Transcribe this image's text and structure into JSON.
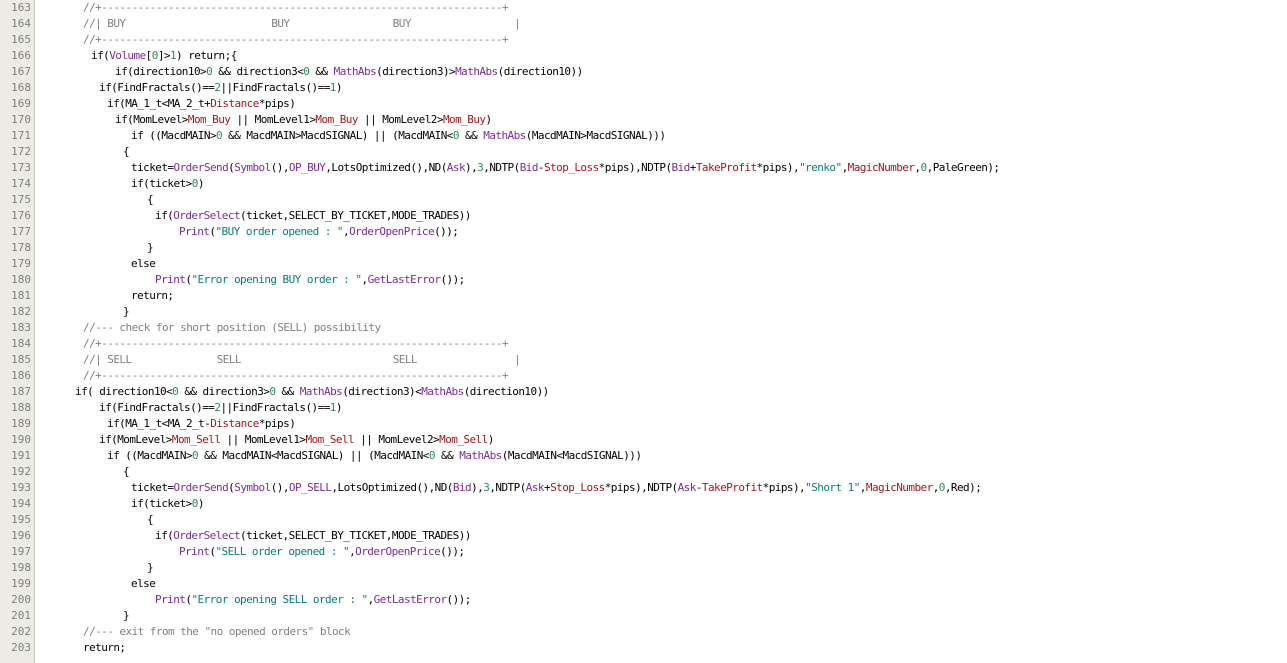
{
  "editor": {
    "gutter_bg": "#ecebe4",
    "colors": {
      "comment": "#808080",
      "function": "#7a2b97",
      "number": "#2e8b57",
      "string": "#0a7a7a",
      "identifier_red": "#a4161a",
      "plain": "#000000"
    },
    "lines": [
      {
        "num": "163",
        "indent": 48,
        "tokens": [
          {
            "t": "//+------------------------------------------------------------------+",
            "c": "c"
          }
        ]
      },
      {
        "num": "164",
        "indent": 48,
        "tokens": [
          {
            "t": "//| BUY                        BUY                 BUY                 |",
            "c": "c"
          }
        ]
      },
      {
        "num": "165",
        "indent": 48,
        "tokens": [
          {
            "t": "//+------------------------------------------------------------------+",
            "c": "c"
          }
        ]
      },
      {
        "num": "166",
        "indent": 56,
        "tokens": [
          {
            "t": "if(",
            "c": "k"
          },
          {
            "t": "Volume",
            "c": "f"
          },
          {
            "t": "[",
            "c": "k"
          },
          {
            "t": "0",
            "c": "n"
          },
          {
            "t": "]>",
            "c": "k"
          },
          {
            "t": "1",
            "c": "n"
          },
          {
            "t": ") return;{",
            "c": "k"
          }
        ]
      },
      {
        "num": "167",
        "indent": 80,
        "tokens": [
          {
            "t": "if(direction10>",
            "c": "k"
          },
          {
            "t": "0",
            "c": "n"
          },
          {
            "t": " && direction3<",
            "c": "k"
          },
          {
            "t": "0",
            "c": "n"
          },
          {
            "t": " && ",
            "c": "k"
          },
          {
            "t": "MathAbs",
            "c": "f"
          },
          {
            "t": "(direction3)>",
            "c": "k"
          },
          {
            "t": "MathAbs",
            "c": "f"
          },
          {
            "t": "(direction10))",
            "c": "k"
          }
        ]
      },
      {
        "num": "168",
        "indent": 64,
        "tokens": [
          {
            "t": "if(FindFractals()==",
            "c": "k"
          },
          {
            "t": "2",
            "c": "n"
          },
          {
            "t": "||FindFractals()==",
            "c": "k"
          },
          {
            "t": "1",
            "c": "n"
          },
          {
            "t": ")",
            "c": "k"
          }
        ]
      },
      {
        "num": "169",
        "indent": 72,
        "tokens": [
          {
            "t": "if(MA_1_t<MA_2_t+",
            "c": "k"
          },
          {
            "t": "Distance",
            "c": "r"
          },
          {
            "t": "*pips)",
            "c": "k"
          }
        ]
      },
      {
        "num": "170",
        "indent": 80,
        "tokens": [
          {
            "t": "if(MomLevel>",
            "c": "k"
          },
          {
            "t": "Mom_Buy",
            "c": "r"
          },
          {
            "t": " || MomLevel1>",
            "c": "k"
          },
          {
            "t": "Mom_Buy",
            "c": "r"
          },
          {
            "t": " || MomLevel2>",
            "c": "k"
          },
          {
            "t": "Mom_Buy",
            "c": "r"
          },
          {
            "t": ")",
            "c": "k"
          }
        ]
      },
      {
        "num": "171",
        "indent": 96,
        "tokens": [
          {
            "t": "if ((MacdMAIN>",
            "c": "k"
          },
          {
            "t": "0",
            "c": "n"
          },
          {
            "t": " && MacdMAIN>MacdSIGNAL) || (MacdMAIN<",
            "c": "k"
          },
          {
            "t": "0",
            "c": "n"
          },
          {
            "t": " && ",
            "c": "k"
          },
          {
            "t": "MathAbs",
            "c": "f"
          },
          {
            "t": "(MacdMAIN>MacdSIGNAL)))",
            "c": "k"
          }
        ]
      },
      {
        "num": "172",
        "indent": 88,
        "tokens": [
          {
            "t": "{",
            "c": "k"
          }
        ]
      },
      {
        "num": "173",
        "indent": 96,
        "tokens": [
          {
            "t": "ticket=",
            "c": "k"
          },
          {
            "t": "OrderSend",
            "c": "f"
          },
          {
            "t": "(",
            "c": "k"
          },
          {
            "t": "Symbol",
            "c": "f"
          },
          {
            "t": "(),",
            "c": "k"
          },
          {
            "t": "OP_BUY",
            "c": "f"
          },
          {
            "t": ",LotsOptimized(),ND(",
            "c": "k"
          },
          {
            "t": "Ask",
            "c": "f"
          },
          {
            "t": "),",
            "c": "k"
          },
          {
            "t": "3",
            "c": "n"
          },
          {
            "t": ",NDTP(",
            "c": "k"
          },
          {
            "t": "Bid",
            "c": "f"
          },
          {
            "t": "-",
            "c": "k"
          },
          {
            "t": "Stop_Loss",
            "c": "r"
          },
          {
            "t": "*pips),NDTP(",
            "c": "k"
          },
          {
            "t": "Bid",
            "c": "f"
          },
          {
            "t": "+",
            "c": "k"
          },
          {
            "t": "TakeProfit",
            "c": "r"
          },
          {
            "t": "*pips),",
            "c": "k"
          },
          {
            "t": "\"renko\"",
            "c": "s"
          },
          {
            "t": ",",
            "c": "k"
          },
          {
            "t": "MagicNumber",
            "c": "r"
          },
          {
            "t": ",",
            "c": "k"
          },
          {
            "t": "0",
            "c": "n"
          },
          {
            "t": ",PaleGreen);",
            "c": "k"
          }
        ]
      },
      {
        "num": "174",
        "indent": 96,
        "tokens": [
          {
            "t": "if(ticket>",
            "c": "k"
          },
          {
            "t": "0",
            "c": "n"
          },
          {
            "t": ")",
            "c": "k"
          }
        ]
      },
      {
        "num": "175",
        "indent": 112,
        "tokens": [
          {
            "t": "{",
            "c": "k"
          }
        ]
      },
      {
        "num": "176",
        "indent": 120,
        "tokens": [
          {
            "t": "if(",
            "c": "k"
          },
          {
            "t": "OrderSelect",
            "c": "f"
          },
          {
            "t": "(ticket,",
            "c": "k"
          },
          {
            "t": "SELECT_BY_TICKET",
            "c": "k"
          },
          {
            "t": ",",
            "c": "k"
          },
          {
            "t": "MODE_TRADES",
            "c": "k"
          },
          {
            "t": "))",
            "c": "k"
          }
        ]
      },
      {
        "num": "177",
        "indent": 144,
        "tokens": [
          {
            "t": "Print",
            "c": "f"
          },
          {
            "t": "(",
            "c": "k"
          },
          {
            "t": "\"BUY order opened : \"",
            "c": "s"
          },
          {
            "t": ",",
            "c": "k"
          },
          {
            "t": "OrderOpenPrice",
            "c": "f"
          },
          {
            "t": "());",
            "c": "k"
          }
        ]
      },
      {
        "num": "178",
        "indent": 112,
        "tokens": [
          {
            "t": "}",
            "c": "k"
          }
        ]
      },
      {
        "num": "179",
        "indent": 96,
        "tokens": [
          {
            "t": "else",
            "c": "k"
          }
        ]
      },
      {
        "num": "180",
        "indent": 120,
        "tokens": [
          {
            "t": "Print",
            "c": "f"
          },
          {
            "t": "(",
            "c": "k"
          },
          {
            "t": "\"Error opening BUY order : \"",
            "c": "s"
          },
          {
            "t": ",",
            "c": "k"
          },
          {
            "t": "GetLastError",
            "c": "f"
          },
          {
            "t": "());",
            "c": "k"
          }
        ]
      },
      {
        "num": "181",
        "indent": 96,
        "tokens": [
          {
            "t": "return;",
            "c": "k"
          }
        ]
      },
      {
        "num": "182",
        "indent": 88,
        "tokens": [
          {
            "t": "}",
            "c": "k"
          }
        ]
      },
      {
        "num": "183",
        "indent": 48,
        "tokens": [
          {
            "t": "//--- check for short position (SELL) possibility",
            "c": "c"
          }
        ]
      },
      {
        "num": "184",
        "indent": 48,
        "tokens": [
          {
            "t": "//+------------------------------------------------------------------+",
            "c": "c"
          }
        ]
      },
      {
        "num": "185",
        "indent": 48,
        "tokens": [
          {
            "t": "//| SELL              SELL                         SELL                |",
            "c": "c"
          }
        ]
      },
      {
        "num": "186",
        "indent": 48,
        "tokens": [
          {
            "t": "//+------------------------------------------------------------------+",
            "c": "c"
          }
        ]
      },
      {
        "num": "187",
        "indent": 40,
        "tokens": [
          {
            "t": "if( direction10<",
            "c": "k"
          },
          {
            "t": "0",
            "c": "n"
          },
          {
            "t": " && direction3>",
            "c": "k"
          },
          {
            "t": "0",
            "c": "n"
          },
          {
            "t": " && ",
            "c": "k"
          },
          {
            "t": "MathAbs",
            "c": "f"
          },
          {
            "t": "(direction3)<",
            "c": "k"
          },
          {
            "t": "MathAbs",
            "c": "f"
          },
          {
            "t": "(direction10))",
            "c": "k"
          }
        ]
      },
      {
        "num": "188",
        "indent": 64,
        "tokens": [
          {
            "t": "if(FindFractals()==",
            "c": "k"
          },
          {
            "t": "2",
            "c": "n"
          },
          {
            "t": "||FindFractals()==",
            "c": "k"
          },
          {
            "t": "1",
            "c": "n"
          },
          {
            "t": ")",
            "c": "k"
          }
        ]
      },
      {
        "num": "189",
        "indent": 72,
        "tokens": [
          {
            "t": "if(MA_1_t<MA_2_t-",
            "c": "k"
          },
          {
            "t": "Distance",
            "c": "r"
          },
          {
            "t": "*pips)",
            "c": "k"
          }
        ]
      },
      {
        "num": "190",
        "indent": 64,
        "tokens": [
          {
            "t": "if(MomLevel>",
            "c": "k"
          },
          {
            "t": "Mom_Sell",
            "c": "r"
          },
          {
            "t": " || MomLevel1>",
            "c": "k"
          },
          {
            "t": "Mom_Sell",
            "c": "r"
          },
          {
            "t": " || MomLevel2>",
            "c": "k"
          },
          {
            "t": "Mom_Sell",
            "c": "r"
          },
          {
            "t": ")",
            "c": "k"
          }
        ]
      },
      {
        "num": "191",
        "indent": 72,
        "tokens": [
          {
            "t": "if ((MacdMAIN>",
            "c": "k"
          },
          {
            "t": "0",
            "c": "n"
          },
          {
            "t": " && MacdMAIN<MacdSIGNAL) || (MacdMAIN<",
            "c": "k"
          },
          {
            "t": "0",
            "c": "n"
          },
          {
            "t": " && ",
            "c": "k"
          },
          {
            "t": "MathAbs",
            "c": "f"
          },
          {
            "t": "(MacdMAIN<MacdSIGNAL)))",
            "c": "k"
          }
        ]
      },
      {
        "num": "192",
        "indent": 88,
        "tokens": [
          {
            "t": "{",
            "c": "k"
          }
        ]
      },
      {
        "num": "193",
        "indent": 96,
        "tokens": [
          {
            "t": "ticket=",
            "c": "k"
          },
          {
            "t": "OrderSend",
            "c": "f"
          },
          {
            "t": "(",
            "c": "k"
          },
          {
            "t": "Symbol",
            "c": "f"
          },
          {
            "t": "(),",
            "c": "k"
          },
          {
            "t": "OP_SELL",
            "c": "f"
          },
          {
            "t": ",LotsOptimized(),ND(",
            "c": "k"
          },
          {
            "t": "Bid",
            "c": "f"
          },
          {
            "t": "),",
            "c": "k"
          },
          {
            "t": "3",
            "c": "n"
          },
          {
            "t": ",NDTP(",
            "c": "k"
          },
          {
            "t": "Ask",
            "c": "f"
          },
          {
            "t": "+",
            "c": "k"
          },
          {
            "t": "Stop_Loss",
            "c": "r"
          },
          {
            "t": "*pips),NDTP(",
            "c": "k"
          },
          {
            "t": "Ask",
            "c": "f"
          },
          {
            "t": "-",
            "c": "k"
          },
          {
            "t": "TakeProfit",
            "c": "r"
          },
          {
            "t": "*pips),",
            "c": "k"
          },
          {
            "t": "\"Short 1\"",
            "c": "s"
          },
          {
            "t": ",",
            "c": "k"
          },
          {
            "t": "MagicNumber",
            "c": "r"
          },
          {
            "t": ",",
            "c": "k"
          },
          {
            "t": "0",
            "c": "n"
          },
          {
            "t": ",Red);",
            "c": "k"
          }
        ]
      },
      {
        "num": "194",
        "indent": 96,
        "tokens": [
          {
            "t": "if(ticket>",
            "c": "k"
          },
          {
            "t": "0",
            "c": "n"
          },
          {
            "t": ")",
            "c": "k"
          }
        ]
      },
      {
        "num": "195",
        "indent": 112,
        "tokens": [
          {
            "t": "{",
            "c": "k"
          }
        ]
      },
      {
        "num": "196",
        "indent": 120,
        "tokens": [
          {
            "t": "if(",
            "c": "k"
          },
          {
            "t": "OrderSelect",
            "c": "f"
          },
          {
            "t": "(ticket,",
            "c": "k"
          },
          {
            "t": "SELECT_BY_TICKET",
            "c": "k"
          },
          {
            "t": ",",
            "c": "k"
          },
          {
            "t": "MODE_TRADES",
            "c": "k"
          },
          {
            "t": "))",
            "c": "k"
          }
        ]
      },
      {
        "num": "197",
        "indent": 144,
        "tokens": [
          {
            "t": "Print",
            "c": "f"
          },
          {
            "t": "(",
            "c": "k"
          },
          {
            "t": "\"SELL order opened : \"",
            "c": "s"
          },
          {
            "t": ",",
            "c": "k"
          },
          {
            "t": "OrderOpenPrice",
            "c": "f"
          },
          {
            "t": "());",
            "c": "k"
          }
        ]
      },
      {
        "num": "198",
        "indent": 112,
        "tokens": [
          {
            "t": "}",
            "c": "k"
          }
        ]
      },
      {
        "num": "199",
        "indent": 96,
        "tokens": [
          {
            "t": "else",
            "c": "k"
          }
        ]
      },
      {
        "num": "200",
        "indent": 120,
        "tokens": [
          {
            "t": "Print",
            "c": "f"
          },
          {
            "t": "(",
            "c": "k"
          },
          {
            "t": "\"Error opening SELL order : \"",
            "c": "s"
          },
          {
            "t": ",",
            "c": "k"
          },
          {
            "t": "GetLastError",
            "c": "f"
          },
          {
            "t": "());",
            "c": "k"
          }
        ]
      },
      {
        "num": "201",
        "indent": 88,
        "tokens": [
          {
            "t": "}",
            "c": "k"
          }
        ]
      },
      {
        "num": "202",
        "indent": 48,
        "tokens": [
          {
            "t": "//--- exit from the \"no opened orders\" block",
            "c": "c"
          }
        ]
      },
      {
        "num": "203",
        "indent": 48,
        "tokens": [
          {
            "t": "return;",
            "c": "k"
          }
        ]
      }
    ]
  }
}
